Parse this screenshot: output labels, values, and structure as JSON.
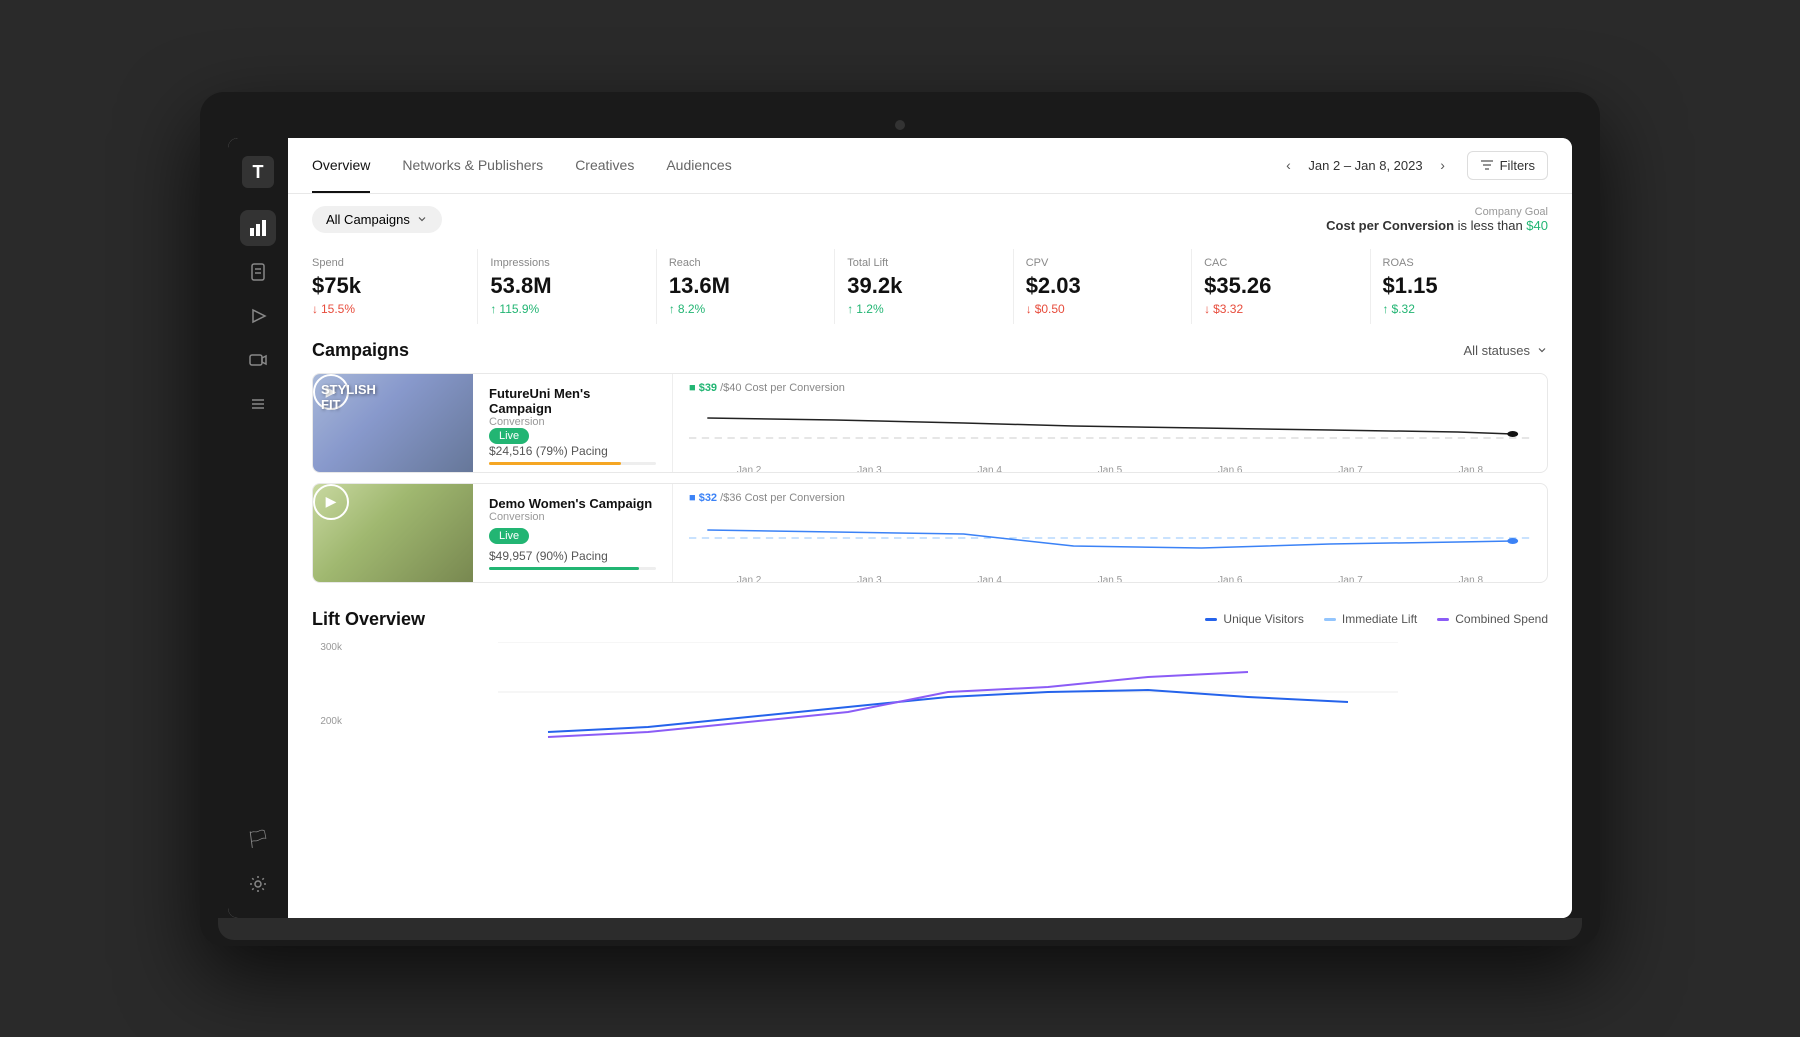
{
  "app": {
    "logo_char": "T"
  },
  "nav": {
    "tabs": [
      {
        "id": "overview",
        "label": "Overview",
        "active": true
      },
      {
        "id": "networks",
        "label": "Networks & Publishers",
        "active": false
      },
      {
        "id": "creatives",
        "label": "Creatives",
        "active": false
      },
      {
        "id": "audiences",
        "label": "Audiences",
        "active": false
      }
    ],
    "date_range": "Jan 2 – Jan 8, 2023",
    "filters_label": "Filters"
  },
  "toolbar": {
    "campaign_filter": "All Campaigns",
    "company_goal_label": "Company Goal",
    "company_goal_text": "Cost per Conversion",
    "company_goal_comparator": "is less than",
    "company_goal_value": "$40"
  },
  "metrics": [
    {
      "id": "spend",
      "label": "Spend",
      "value": "$75k",
      "change": "15.5%",
      "direction": "down"
    },
    {
      "id": "impressions",
      "label": "Impressions",
      "value": "53.8M",
      "change": "115.9%",
      "direction": "up"
    },
    {
      "id": "reach",
      "label": "Reach",
      "value": "13.6M",
      "change": "8.2%",
      "direction": "up"
    },
    {
      "id": "total_lift",
      "label": "Total Lift",
      "value": "39.2k",
      "change": "1.2%",
      "direction": "up"
    },
    {
      "id": "cpv",
      "label": "CPV",
      "value": "$2.03",
      "change": "$0.50",
      "direction": "down"
    },
    {
      "id": "cac",
      "label": "CAC",
      "value": "$35.26",
      "change": "$3.32",
      "direction": "down"
    },
    {
      "id": "roas",
      "label": "ROAS",
      "value": "$1.15",
      "change": "$.32",
      "direction": "up"
    }
  ],
  "campaigns": {
    "title": "Campaigns",
    "status_filter": "All statuses",
    "items": [
      {
        "id": "futureuni",
        "name": "FutureUni Men's Campaign",
        "type": "Conversion",
        "status": "Live",
        "spend": "$24,516 (79%) Pacing",
        "pacing_pct": 79,
        "thumb_label": "STYLISH\nFIT",
        "thumb_style": "stylish",
        "cpc_current": "$39",
        "cpc_goal": "$40",
        "cpc_label": "Cost per Conversion"
      },
      {
        "id": "demowomen",
        "name": "Demo Women's Campaign",
        "type": "Conversion",
        "status": "Live",
        "spend": "$49,957 (90%) Pacing",
        "pacing_pct": 90,
        "thumb_label": "",
        "thumb_style": "demo",
        "cpc_current": "$32",
        "cpc_goal": "$36",
        "cpc_label": "Cost per Conversion"
      }
    ],
    "x_labels": [
      "Jan 2",
      "Jan 3",
      "Jan 4",
      "Jan 5",
      "Jan 6",
      "Jan 7",
      "Jan 8"
    ]
  },
  "lift_overview": {
    "title": "Lift Overview",
    "legend": [
      {
        "id": "unique_visitors",
        "label": "Unique Visitors",
        "style": "blue-solid"
      },
      {
        "id": "immediate_lift",
        "label": "Immediate Lift",
        "style": "light-blue"
      },
      {
        "id": "combined_spend",
        "label": "Combined Spend",
        "style": "purple"
      }
    ],
    "y_labels": [
      "300k",
      "200k"
    ],
    "x_labels": []
  },
  "sidebar": {
    "icons": [
      {
        "id": "chart",
        "label": "Analytics",
        "active": true,
        "char": "📊"
      },
      {
        "id": "doc",
        "label": "Documents",
        "active": false,
        "char": "📄"
      },
      {
        "id": "send",
        "label": "Campaigns",
        "active": false,
        "char": "▷"
      },
      {
        "id": "video",
        "label": "Video",
        "active": false,
        "char": "▶"
      },
      {
        "id": "list",
        "label": "Reports",
        "active": false,
        "char": "≡"
      }
    ],
    "bottom_icons": [
      {
        "id": "flag",
        "label": "Flag",
        "active": false,
        "char": "🏳"
      },
      {
        "id": "settings",
        "label": "Settings",
        "active": false,
        "char": "⚙"
      }
    ]
  }
}
